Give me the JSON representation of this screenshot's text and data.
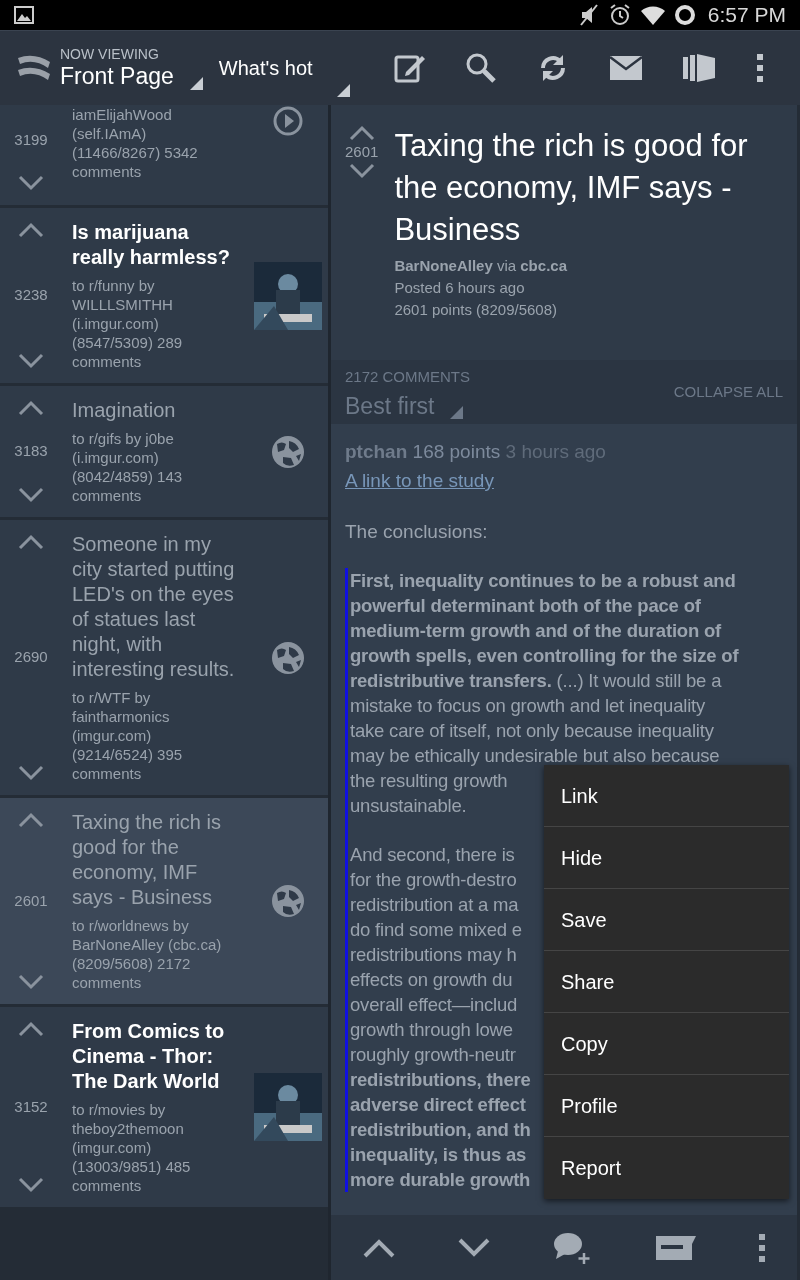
{
  "status_bar": {
    "time": "6:57 PM"
  },
  "top_bar": {
    "caption": "NOW VIEWING",
    "page": "Front Page",
    "sort": "What's hot"
  },
  "posts": [
    {
      "score": "3199",
      "source": "iamElijahWood (self.IAmA)",
      "stats": "(11466/8267) 5342 comments",
      "selected": false,
      "thumb": {
        "kind": "play"
      }
    },
    {
      "score": "3238",
      "title": "Is marijuana really harmless?",
      "source": "to r/funny by WILLLSMITHH (i.imgur.com)",
      "stats": "(8547/5309) 289 comments",
      "visited": false,
      "selected": false
    },
    {
      "score": "3183",
      "title": "Imagination",
      "source": "to r/gifs by j0be (i.imgur.com)",
      "stats": "(8042/4859) 143 comments",
      "visited": true,
      "selected": false,
      "thumb": {
        "kind": "globe"
      }
    },
    {
      "score": "2690",
      "title": "Someone in my city started putting LED's on the eyes of statues last night, with interesting results.",
      "source": "to r/WTF by faintharmonics (imgur.com)",
      "stats": "(9214/6524) 395 comments",
      "visited": true,
      "selected": false,
      "thumb": {
        "kind": "globe"
      }
    },
    {
      "score": "2601",
      "title": "Taxing the rich is good for the economy, IMF says - Business",
      "source": "to r/worldnews by BarNoneAlley (cbc.ca)",
      "stats": "(8209/5608) 2172 comments",
      "visited": true,
      "selected": true,
      "thumb": {
        "kind": "globe"
      }
    },
    {
      "score": "3152",
      "title": "From Comics to Cinema - Thor: The Dark World",
      "source": "to r/movies by theboy2themoon (imgur.com)",
      "stats": "(13003/9851) 485 comments",
      "visited": false,
      "selected": false
    }
  ],
  "detail": {
    "score": "2601",
    "title": "Taxing the rich is good for the economy, IMF says - Business",
    "author": "BarNoneAlley",
    "via": "via",
    "domain": "cbc.ca",
    "posted": "Posted 6 hours ago",
    "points": "2601 points (8209/5608)"
  },
  "comments_header": {
    "count": "2172 COMMENTS",
    "sort": "Best first",
    "collapse": "COLLAPSE ALL"
  },
  "comment": {
    "author": "ptchan",
    "points": "168 points",
    "age": "3 hours ago",
    "link": "A link to the study",
    "intro": "The conclusions:",
    "quote": [
      [
        {
          "text": "First, inequality continues to be a robust and",
          "bold": true
        },
        {
          "text": "powerful determinant both of the pace of",
          "bold": true
        },
        {
          "text": "medium-term growth and of the duration of",
          "bold": true
        },
        {
          "text": "growth spells, even controlling for the size of",
          "bold": true
        },
        {
          "text": "**redistributive transfers.** (...) It would still be a",
          "bold": false
        },
        {
          "text": "mistake to focus on growth and let inequality",
          "bold": false
        },
        {
          "text": "take care of itself, not only because inequality",
          "bold": false
        },
        {
          "text": "may be ethically undesirable but also because",
          "bold": false
        },
        {
          "text": "the resulting growth",
          "bold": false
        },
        {
          "text": "unsustainable.",
          "bold": false
        }
      ],
      [
        {
          "text": "And second, there is",
          "bold": false
        },
        {
          "text": "for the growth-destro",
          "bold": false
        },
        {
          "text": "redistribution at a ma",
          "bold": false
        },
        {
          "text": "do find some mixed e",
          "bold": false
        },
        {
          "text": "redistributions may h",
          "bold": false
        },
        {
          "text": "effects on growth du",
          "bold": false
        },
        {
          "text": "overall effect—includ",
          "bold": false
        },
        {
          "text": "growth through lowe",
          "bold": false
        },
        {
          "text": "roughly growth-neutr",
          "bold": false
        },
        {
          "text": "redistributions, there",
          "bold": true
        },
        {
          "text": "adverse direct effect",
          "bold": true
        },
        {
          "text": "redistribution, and th",
          "bold": true
        },
        {
          "text": "inequality, is thus as",
          "bold": true
        },
        {
          "text": "more durable growth",
          "bold": true
        }
      ]
    ]
  },
  "menu": [
    "Link",
    "Hide",
    "Save",
    "Share",
    "Copy",
    "Profile",
    "Report"
  ]
}
